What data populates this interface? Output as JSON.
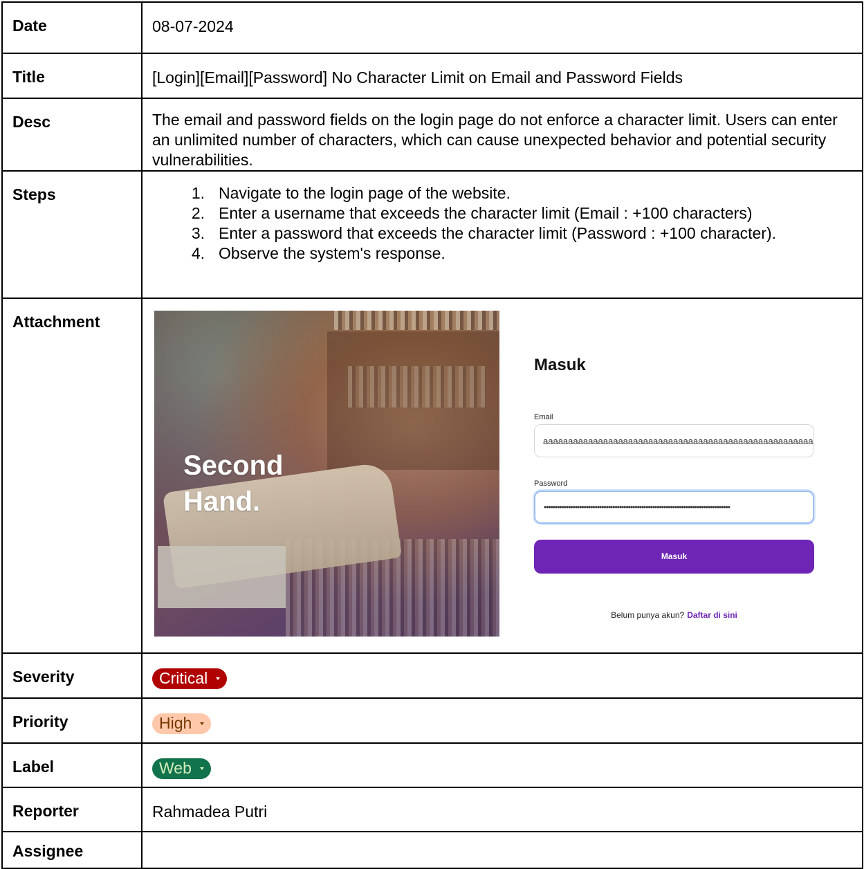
{
  "rows": {
    "date": {
      "label": "Date",
      "value": "08-07-2024"
    },
    "title": {
      "label": "Title",
      "value": "[Login][Email][Password] No Character Limit on Email and Password Fields"
    },
    "desc": {
      "label": "Desc",
      "value": "The email and password fields on the login page do not enforce a character limit. Users can enter an unlimited number of characters, which can cause unexpected behavior and potential security vulnerabilities."
    },
    "steps": {
      "label": "Steps",
      "items": [
        "Navigate to the login page of the website.",
        "Enter a username that exceeds the character limit (Email : +100 characters)",
        "Enter a password that exceeds the character limit (Password : +100 character).",
        "Observe the system's response."
      ]
    },
    "attachment": {
      "label": "Attachment"
    },
    "severity": {
      "label": "Severity",
      "value": "Critical",
      "color": "#b10202"
    },
    "priority": {
      "label": "Priority",
      "value": "High",
      "color": "#ffc8aa"
    },
    "label": {
      "label": "Label",
      "value": "Web",
      "color": "#11734b"
    },
    "reporter": {
      "label": "Reporter",
      "value": "Rahmadea Putri"
    },
    "assignee": {
      "label": "Assignee",
      "value": ""
    }
  },
  "attachment_screenshot": {
    "brand": "Second Hand.",
    "heading": "Masuk",
    "email_label": "Email",
    "email_value": "aaaaaaaaaaaaaaaaaaaaaaaaaaaaaaaaaaaaaaaaaaaaaaaaaaaaaaaaaa",
    "password_label": "Password",
    "password_mask": "••••••••••••••••••••••••••••••••••••••••••••••••••••••••••••••••••••••••••••••••••••",
    "button_label": "Masuk",
    "signup_text": "Belum punya akun?",
    "signup_link": "Daftar di sini",
    "accent_color": "#6e25b6"
  }
}
